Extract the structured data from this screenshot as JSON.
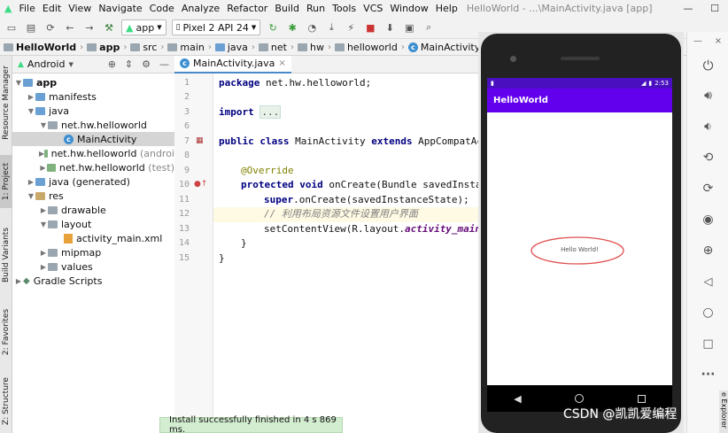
{
  "menu": {
    "items": [
      "File",
      "Edit",
      "View",
      "Navigate",
      "Code",
      "Analyze",
      "Refactor",
      "Build",
      "Run",
      "Tools",
      "VCS",
      "Window",
      "Help"
    ],
    "window_title": "HelloWorld - ...\\MainActivity.java [app]"
  },
  "toolbar": {
    "run_config": "app",
    "device": "Pixel 2 API 24"
  },
  "breadcrumb": [
    "HelloWorld",
    "app",
    "src",
    "main",
    "java",
    "net",
    "hw",
    "helloworld",
    "MainActivity"
  ],
  "left_strip": {
    "resource_manager": "Resource Manager",
    "project": "1: Project",
    "build_variants": "Build Variants",
    "favorites": "2: Favorites",
    "structure": "Z: Structure"
  },
  "project_panel": {
    "view_mode": "Android",
    "tree": [
      {
        "label": "app",
        "bold": true,
        "suffix": ""
      },
      {
        "label": "manifests",
        "suffix": ""
      },
      {
        "label": "java",
        "suffix": ""
      },
      {
        "label": "net.hw.helloworld",
        "suffix": ""
      },
      {
        "label": "MainActivity",
        "suffix": ""
      },
      {
        "label": "net.hw.helloworld",
        "suffix": "(androi"
      },
      {
        "label": "net.hw.helloworld",
        "suffix": "(test)"
      },
      {
        "label": "java (generated)",
        "suffix": ""
      },
      {
        "label": "res",
        "suffix": ""
      },
      {
        "label": "drawable",
        "suffix": ""
      },
      {
        "label": "layout",
        "suffix": ""
      },
      {
        "label": "activity_main.xml",
        "suffix": ""
      },
      {
        "label": "mipmap",
        "suffix": ""
      },
      {
        "label": "values",
        "suffix": ""
      },
      {
        "label": "Gradle Scripts",
        "suffix": ""
      }
    ]
  },
  "editor": {
    "tab_label": "MainActivity.java",
    "line_numbers": [
      "1",
      "2",
      "3",
      "6",
      "7",
      "8",
      "9",
      "10",
      "11",
      "12",
      "13",
      "14",
      "15"
    ],
    "code": {
      "l1_kw": "package",
      "l1_rest": " net.hw.helloworld;",
      "l3_kw": "import",
      "l3_fold": "...",
      "l7_kw1": "public class",
      "l7_mid": " MainActivity ",
      "l7_kw2": "extends",
      "l7_rest": " AppCompatAct",
      "l9_ann": "@Override",
      "l10_kw": "protected void",
      "l10_rest": " onCreate(Bundle savedInstan",
      "l11_kw": "super",
      "l11_rest": ".onCreate(savedInstanceState);",
      "l12_comment": "// 利用布局资源文件设置用户界面",
      "l13_a": "setContentView(R.layout.",
      "l13_fn": "activity_main",
      "l13_b": ")",
      "l14": "}",
      "l15": "}"
    }
  },
  "emulator": {
    "time": "2:53",
    "app_title": "HelloWorld",
    "hello_text": "Hello World!",
    "app_bar_color": "#6200ee"
  },
  "notification": "Install successfully finished in 4 s 869 ms.",
  "watermark": "CSDN @凯凯爱编程",
  "right_edge_label": "e Explorer"
}
